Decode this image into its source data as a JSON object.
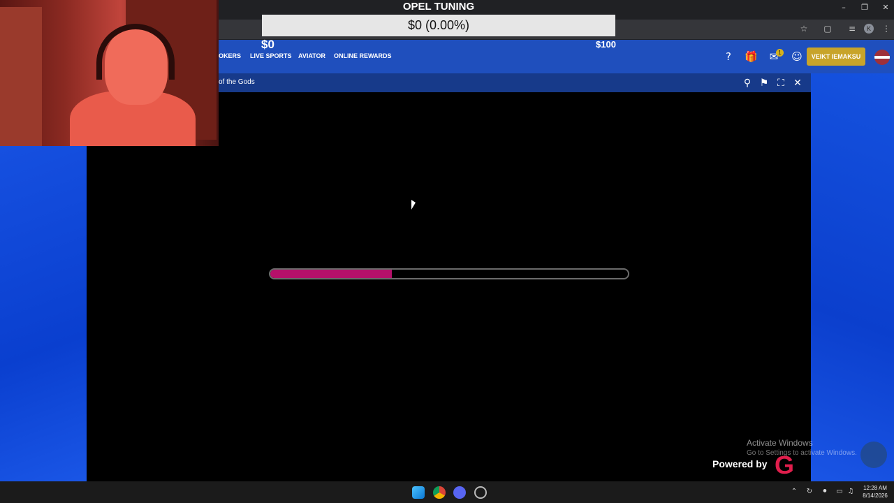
{
  "overlay": {
    "title": "OPEL TUNING",
    "balance_display": "$0 (0.00%)",
    "min_label": "$0",
    "max_label": "$100"
  },
  "site_nav": {
    "items": [
      "OKERS",
      "LIVE SPORTS",
      "AVIATOR",
      "ONLINE REWARDS"
    ],
    "deposit_button": "VEIKT IEMAKSU",
    "notification_count": "1"
  },
  "game": {
    "title": "of the Gods",
    "loading_progress": 0.34,
    "progress_color": "#b5106a",
    "powered_by": "Powered by",
    "provider_logo_icon": "g-logo-icon"
  },
  "windows_watermark": {
    "title": "Activate Windows",
    "subtitle": "Go to Settings to activate Windows."
  },
  "browser": {
    "profile_initial": "K"
  },
  "taskbar": {
    "time": "12:28 AM",
    "date": "8/14/2026"
  },
  "colors": {
    "site_blue": "#1f4fbd",
    "deposit_gold": "#c8a42a"
  }
}
